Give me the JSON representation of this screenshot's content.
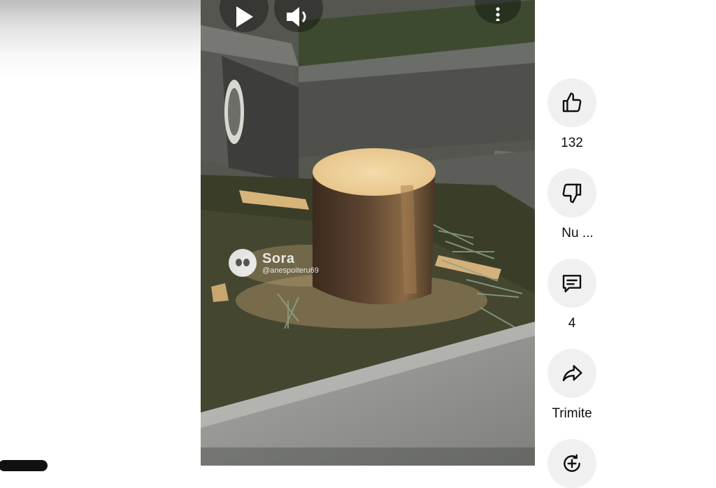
{
  "video": {
    "watermark_brand": "Sora",
    "watermark_handle": "@anespoiteru69"
  },
  "actions": {
    "like": {
      "icon": "thumbs-up-icon",
      "label": "132"
    },
    "dislike": {
      "icon": "thumbs-down-icon",
      "label": "Nu ..."
    },
    "comments": {
      "icon": "comment-icon",
      "label": "4"
    },
    "share": {
      "icon": "share-icon",
      "label": "Trimite"
    },
    "remix": {
      "icon": "remix-icon"
    }
  },
  "colors": {
    "rail_button_bg": "#f0f0f0",
    "text": "#0f0f0f"
  }
}
